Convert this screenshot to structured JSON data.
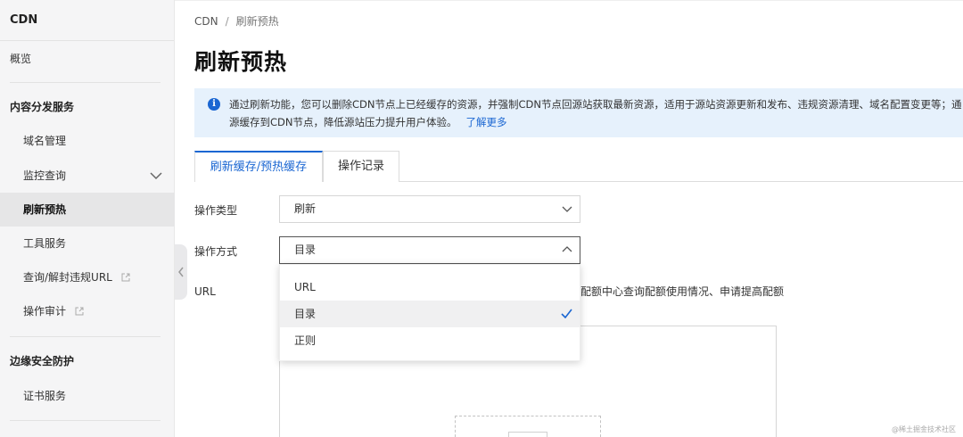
{
  "sidebar": {
    "title": "CDN",
    "overview": "概览",
    "group1": "内容分发服务",
    "items": {
      "domain": "域名管理",
      "monitor": "监控查询",
      "refresh": "刷新预热",
      "tools": "工具服务",
      "url_block": "查询/解封违规URL",
      "audit": "操作审计"
    },
    "group2": "边缘安全防护",
    "cert": "证书服务"
  },
  "breadcrumb": {
    "root": "CDN",
    "separator": "/",
    "current": "刷新预热"
  },
  "page_title": "刷新预热",
  "alert": {
    "line1": "通过刷新功能，您可以删除CDN节点上已经缓存的资源，并强制CDN节点回源站获取最新资源，适用于源站资源更新和发布、违规资源清理、域名配置变更等；通",
    "line2": "源缓存到CDN节点，降低源站压力提升用户体验。",
    "link": "了解更多"
  },
  "tabs": {
    "active": "刷新缓存/预热缓存",
    "other": "操作记录"
  },
  "form": {
    "op_type_label": "操作类型",
    "op_type_value": "刷新",
    "op_method_label": "操作方式",
    "op_method_value": "目录",
    "url_label": "URL",
    "hint": "配额中心查询配额使用情况、申请提高配额"
  },
  "dropdown": {
    "options": [
      "URL",
      "目录",
      "正则"
    ],
    "selected": "目录"
  },
  "watermark": "@稀土掘金技术社区",
  "colors": {
    "accent": "#1a66d2",
    "alert_bg": "#e6f1fc",
    "sidebar_bg": "#f5f5f6"
  }
}
